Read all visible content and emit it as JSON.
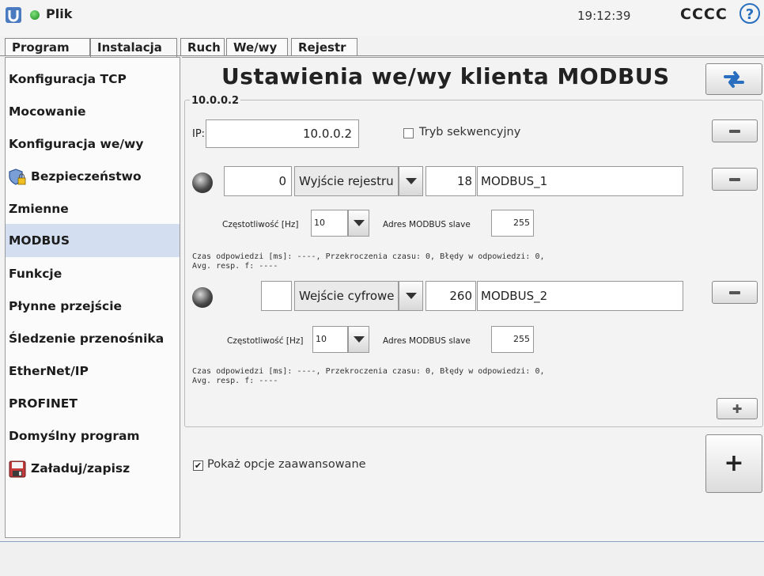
{
  "topbar": {
    "file_label": "Plik",
    "clock": "19:12:39",
    "robot_name": "CCCC",
    "help_label": "?"
  },
  "tabs": [
    {
      "label": "Program"
    },
    {
      "label": "Instalacja"
    },
    {
      "label": "Ruch"
    },
    {
      "label": "We/wy"
    },
    {
      "label": "Rejestr"
    }
  ],
  "sidebar": {
    "items": [
      {
        "label": "Konfiguracja TCP"
      },
      {
        "label": "Mocowanie"
      },
      {
        "label": "Konfiguracja we/wy"
      },
      {
        "label": "Bezpieczeństwo"
      },
      {
        "label": "Zmienne"
      },
      {
        "label": "MODBUS"
      },
      {
        "label": "Funkcje"
      },
      {
        "label": "Płynne przejście"
      },
      {
        "label": "Śledzenie przenośnika"
      },
      {
        "label": "EtherNet/IP"
      },
      {
        "label": "PROFINET"
      },
      {
        "label": "Domyślny program"
      },
      {
        "label": "Załaduj/zapisz"
      }
    ]
  },
  "main": {
    "title": "Ustawienia we/wy klienta MODBUS",
    "group_label": "10.0.0.2",
    "ip_label": "IP:",
    "ip_value": "10.0.0.2",
    "sequential_label": "Tryb sekwencyjny",
    "signals": [
      {
        "address": "0",
        "type": "Wyjście rejestru",
        "register": "18",
        "name": "MODBUS_1",
        "freq_label": "Częstotliwość [Hz]",
        "freq_value": "10",
        "slave_label": "Adres MODBUS slave",
        "slave_value": "255",
        "response_line1": "Czas odpowiedzi [ms]: ----, Przekroczenia czasu: 0, Błędy w odpowiedzi: 0,",
        "response_line2": "Avg. resp. f: ----"
      },
      {
        "address": "",
        "type": "Wejście cyfrowe",
        "register": "260",
        "name": "MODBUS_2",
        "freq_label": "Częstotliwość [Hz]",
        "freq_value": "10",
        "slave_label": "Adres MODBUS slave",
        "slave_value": "255",
        "response_line1": "Czas odpowiedzi [ms]: ----, Przekroczenia czasu: 0, Błędy w odpowiedzi: 0,",
        "response_line2": "Avg. resp. f: ----"
      }
    ],
    "advanced_label": "Pokaż opcje zaawansowane",
    "advanced_checked": "✔",
    "add_big_label": "+",
    "add_small_label": "✚"
  },
  "colors": {
    "accent": "#2a6fbf",
    "active_sidebar": "#d3dff0",
    "status_green": "#1a8a1a"
  }
}
